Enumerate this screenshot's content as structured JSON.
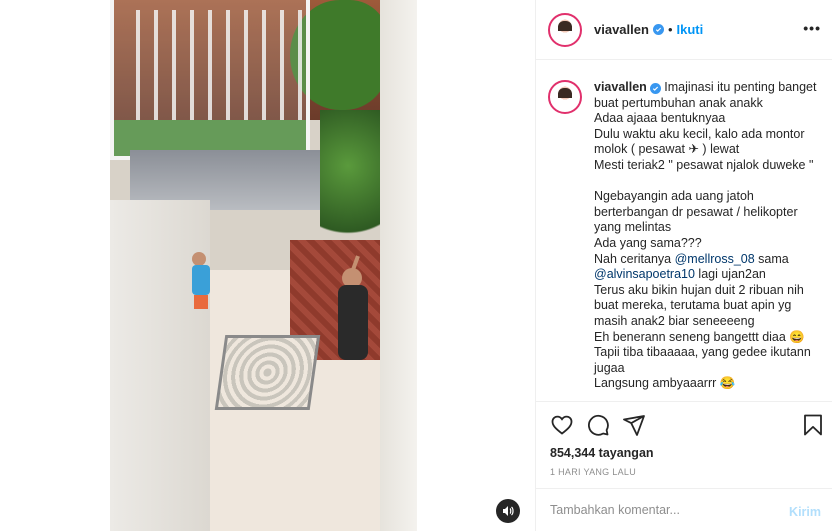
{
  "header": {
    "username": "viavallen",
    "follow_label": "Ikuti",
    "dot": "•",
    "more_label": "•••"
  },
  "caption": {
    "username": "viavallen",
    "text_before_mention1": " Imajinasi itu penting banget buat pertumbuhan anak anakk\nAdaa ajaaa bentuknyaa\nDulu waktu aku kecil, kalo ada montor molok ( pesawat ✈ ) lewat\nMesti teriak2 \" pesawat njalok duweke \"\n\nNgebayangin ada uang jatoh berterbangan dr pesawat / helikopter yang melintas\nAda yang sama???\nNah ceritanya ",
    "mention1": "@mellross_08",
    "text_between": " sama ",
    "mention2": "@alvinsapoetra10",
    "text_after": " lagi ujan2an\nTerus aku bikin hujan duit 2 ribuan nih buat mereka, terutama buat apin yg masih anak2 biar seneeeeng\nEh benerann seneng bangettt diaa 😄\nTapii tiba tibaaaaa, yang gedee ikutann jugaa\nLangsung ambyaaarrr 😂"
  },
  "stats": {
    "views": "854,344 tayangan",
    "date": "1 HARI YANG LALU"
  },
  "comment": {
    "placeholder": "Tambahkan komentar...",
    "post_label": "Kirim"
  },
  "icons": {
    "like": "heart-icon",
    "comment": "comment-icon",
    "share": "share-icon",
    "save": "bookmark-icon",
    "sound": "speaker-icon",
    "verified": "verified-badge-icon"
  },
  "colors": {
    "accent": "#0095f6",
    "verified": "#3897f0",
    "story_ring": "#e1306c",
    "muted": "#8e8e8e",
    "post_disabled": "#b2dffc"
  }
}
